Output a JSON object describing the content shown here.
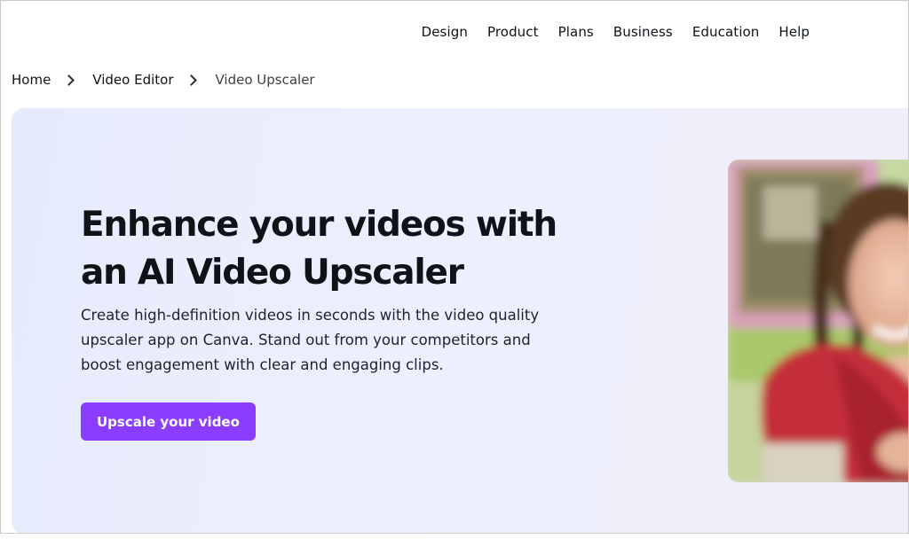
{
  "nav": {
    "items": [
      "Design",
      "Product",
      "Plans",
      "Business",
      "Education",
      "Help"
    ]
  },
  "breadcrumb": {
    "home": "Home",
    "parent": "Video Editor",
    "current": "Video Upscaler"
  },
  "hero": {
    "title": "Enhance your videos with an AI Video Upscaler",
    "description": "Create high-definition videos in seconds with the video quality upscaler app on Canva. Stand out from your competitors and boost engagement with clear and engaging clips.",
    "cta_label": "Upscale your video",
    "image": "blurred-photo-of-smiling-girl-with-braids"
  },
  "colors": {
    "accent": "#8b3dff",
    "hero_bg": "#e8ecfc",
    "text": "#0e1318"
  }
}
